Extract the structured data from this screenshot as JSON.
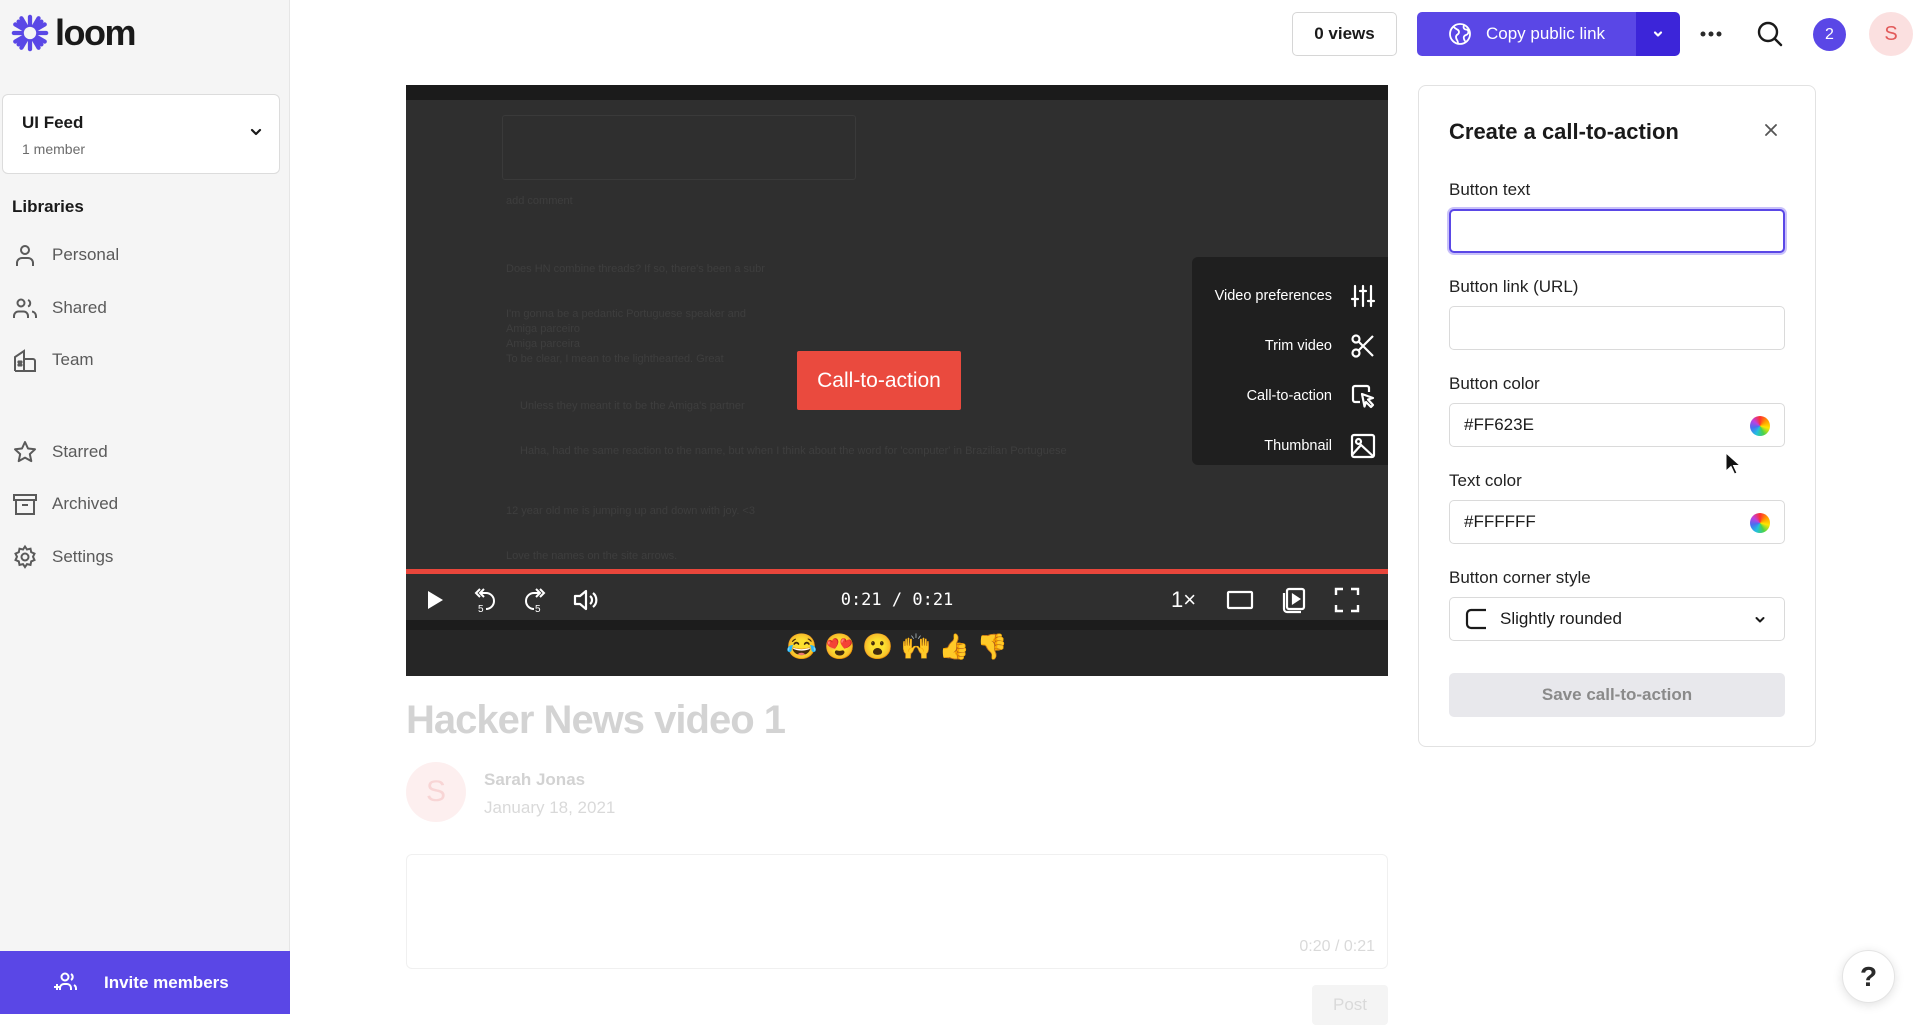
{
  "app": {
    "name": "loom"
  },
  "sidebar": {
    "workspace": {
      "name": "UI Feed",
      "members": "1 member"
    },
    "libraries_title": "Libraries",
    "libraries": [
      {
        "label": "Personal",
        "icon": "person-icon"
      },
      {
        "label": "Shared",
        "icon": "people-icon"
      },
      {
        "label": "Team",
        "icon": "building-icon"
      }
    ],
    "secondary": [
      {
        "label": "Starred",
        "icon": "star-icon"
      },
      {
        "label": "Archived",
        "icon": "archive-icon"
      },
      {
        "label": "Settings",
        "icon": "gear-icon"
      }
    ],
    "invite_label": "Invite members"
  },
  "topbar": {
    "views_label": "0 views",
    "copy_link_label": "Copy public link",
    "notification_count": "2",
    "avatar_initial": "S"
  },
  "video": {
    "cta_preview_label": "Call-to-action",
    "time_display": "0:21 / 0:21",
    "playback_speed": "1×",
    "progress_fraction": 1.0,
    "tools": [
      {
        "label": "Video preferences",
        "icon": "sliders-icon"
      },
      {
        "label": "Trim video",
        "icon": "scissors-icon"
      },
      {
        "label": "Call-to-action",
        "icon": "cursor-box-icon"
      },
      {
        "label": "Thumbnail",
        "icon": "image-icon"
      }
    ],
    "reactions": [
      "😂",
      "😍",
      "😮",
      "🙌",
      "👍",
      "👎"
    ],
    "background_text": {
      "add_comment": "add comment",
      "lines": [
        "Does HN combine threads? If so, there's been a subr",
        "I'm gonna be a pedantic Portuguese speaker and",
        "Amiga parceiro",
        "Amiga parceira",
        "To be clear, I mean to the lighthearted. Great",
        "Unless they meant it to be the Amiga's partner",
        "Haha, had the same reaction to the name, but when I think about the word for 'computer' in Brazilian Portuguese",
        "12 year old me is jumping up and down with joy. <3",
        "Love the names on the site arrows."
      ]
    }
  },
  "video_meta": {
    "title": "Hacker News video 1",
    "author_initial": "S",
    "author": "Sarah Jonas",
    "date": "January 18, 2021",
    "comment_timestamp": "0:20 / 0:21",
    "post_label": "Post"
  },
  "cta_panel": {
    "title": "Create a call-to-action",
    "button_text_label": "Button text",
    "button_text_value": "",
    "button_link_label": "Button link (URL)",
    "button_link_value": "",
    "button_color_label": "Button color",
    "button_color_value": "#FF623E",
    "text_color_label": "Text color",
    "text_color_value": "#FFFFFF",
    "corner_style_label": "Button corner style",
    "corner_style_value": "Slightly rounded",
    "save_label": "Save call-to-action"
  },
  "colors": {
    "brand": "#5a47e6",
    "brand_dark": "#3c25d9",
    "cta_red": "#ea4a3e",
    "progress": "#e8463b"
  },
  "help_label": "?"
}
